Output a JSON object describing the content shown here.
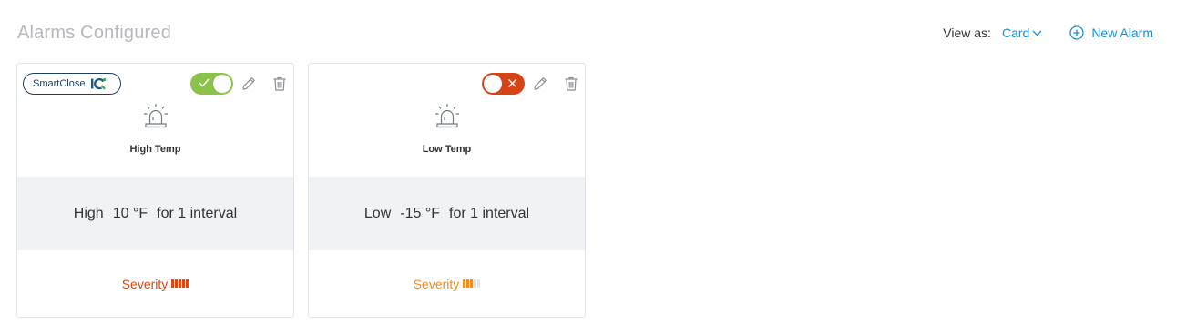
{
  "header": {
    "title": "Alarms Configured",
    "view_as_label": "View as:",
    "view_value": "Card",
    "new_alarm_label": "New Alarm"
  },
  "colors": {
    "accent": "#1a8fd1",
    "toggle_on": "#8bc34a",
    "toggle_off": "#d84315",
    "severity_high": "#e0450f",
    "severity_medium": "#f28c1e",
    "severity_inactive": "#e5e5e5",
    "card_band": "#f0f2f5"
  },
  "cards": [
    {
      "badge": "SmartClose",
      "badge_logo": "IQ",
      "enabled": true,
      "icon": "alarm-siren-icon",
      "name": "High Temp",
      "condition": {
        "direction": "High",
        "value": "10",
        "unit": "°F",
        "for_text": "for",
        "count": "1",
        "interval_text": "interval"
      },
      "severity_label": "Severity",
      "severity_level": 5,
      "severity_max": 5,
      "severity_color": "#e0450f"
    },
    {
      "badge": "",
      "enabled": false,
      "icon": "alarm-siren-icon",
      "name": "Low Temp",
      "condition": {
        "direction": "Low",
        "value": "-15",
        "unit": "°F",
        "for_text": "for",
        "count": "1",
        "interval_text": "interval"
      },
      "severity_label": "Severity",
      "severity_level": 3,
      "severity_max": 5,
      "severity_color": "#f28c1e"
    }
  ]
}
